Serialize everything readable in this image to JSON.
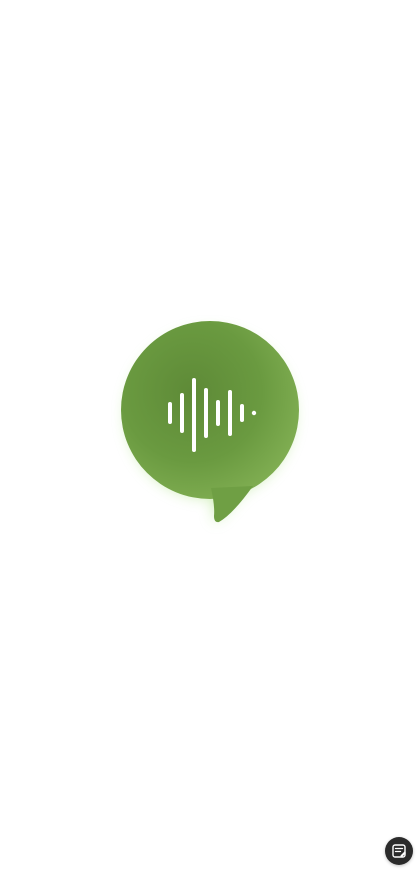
{
  "app": {
    "screen": "splash",
    "logo_icon": "sound-wave-speech-bubble-icon",
    "brand_color": "#6a9a40",
    "brand_color_light": "#86b558",
    "brand_color_dark": "#5a8534",
    "glow_color": "#a6e07a"
  },
  "floating_button": {
    "icon": "notes-edit-icon",
    "background": "#2b2b2b",
    "foreground": "#ffffff"
  }
}
